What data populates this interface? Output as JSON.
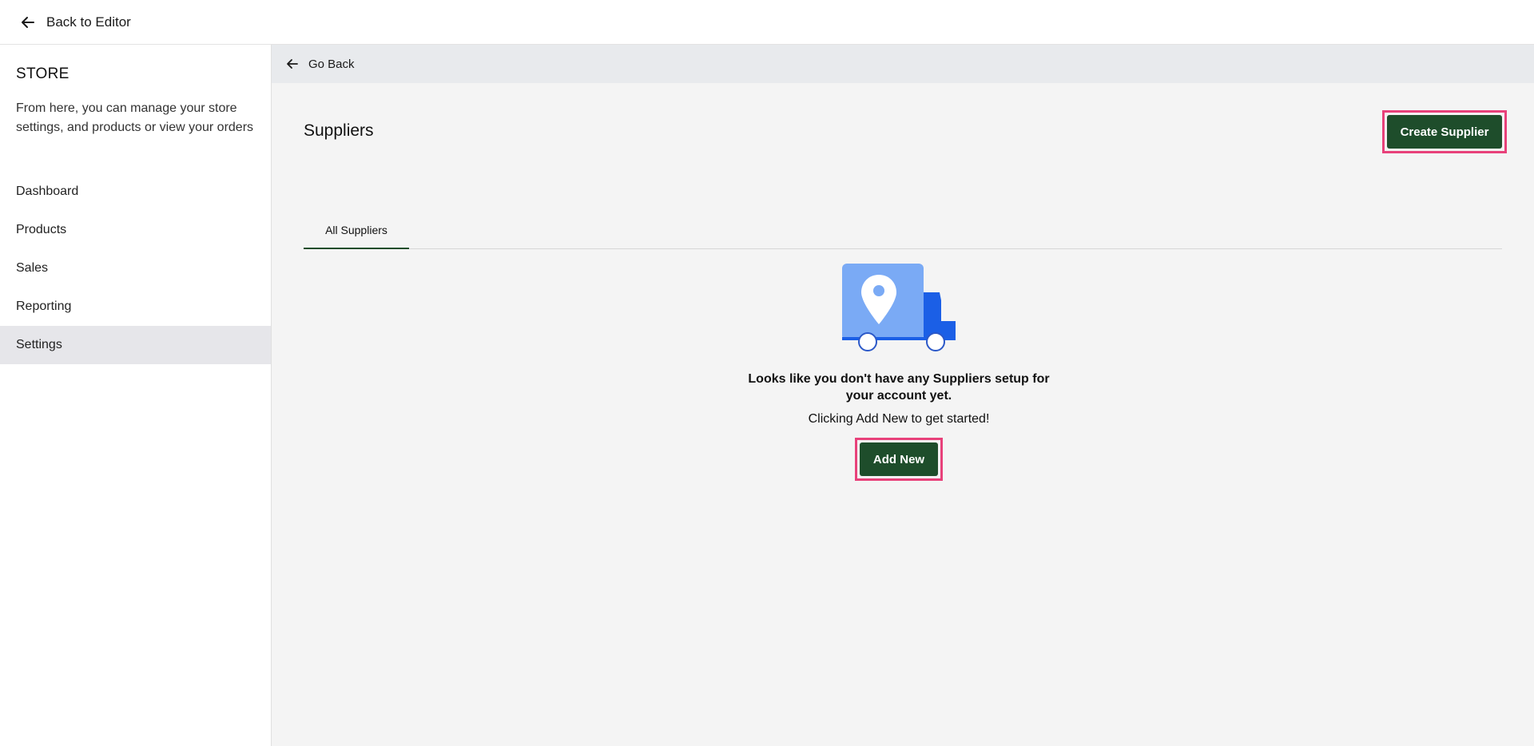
{
  "topbar": {
    "back_label": "Back to Editor"
  },
  "sidebar": {
    "title": "STORE",
    "description": "From here, you can manage your store settings, and products or view your orders",
    "items": [
      {
        "label": "Dashboard"
      },
      {
        "label": "Products"
      },
      {
        "label": "Sales"
      },
      {
        "label": "Reporting"
      },
      {
        "label": "Settings",
        "active": true
      }
    ]
  },
  "main": {
    "go_back_label": "Go Back",
    "title": "Suppliers",
    "create_button_label": "Create Supplier",
    "tabs": [
      {
        "label": "All Suppliers",
        "active": true
      }
    ],
    "empty_state": {
      "icon": "delivery-truck-icon",
      "headline": "Looks like you don't have any Suppliers setup for your account yet.",
      "subtext": "Clicking Add New to get started!",
      "button_label": "Add New"
    }
  },
  "colors": {
    "primary_button": "#1e4d2b",
    "highlight_outline": "#e8417a",
    "truck_body": "#7aaaf5",
    "truck_cab": "#1b5fe6"
  }
}
